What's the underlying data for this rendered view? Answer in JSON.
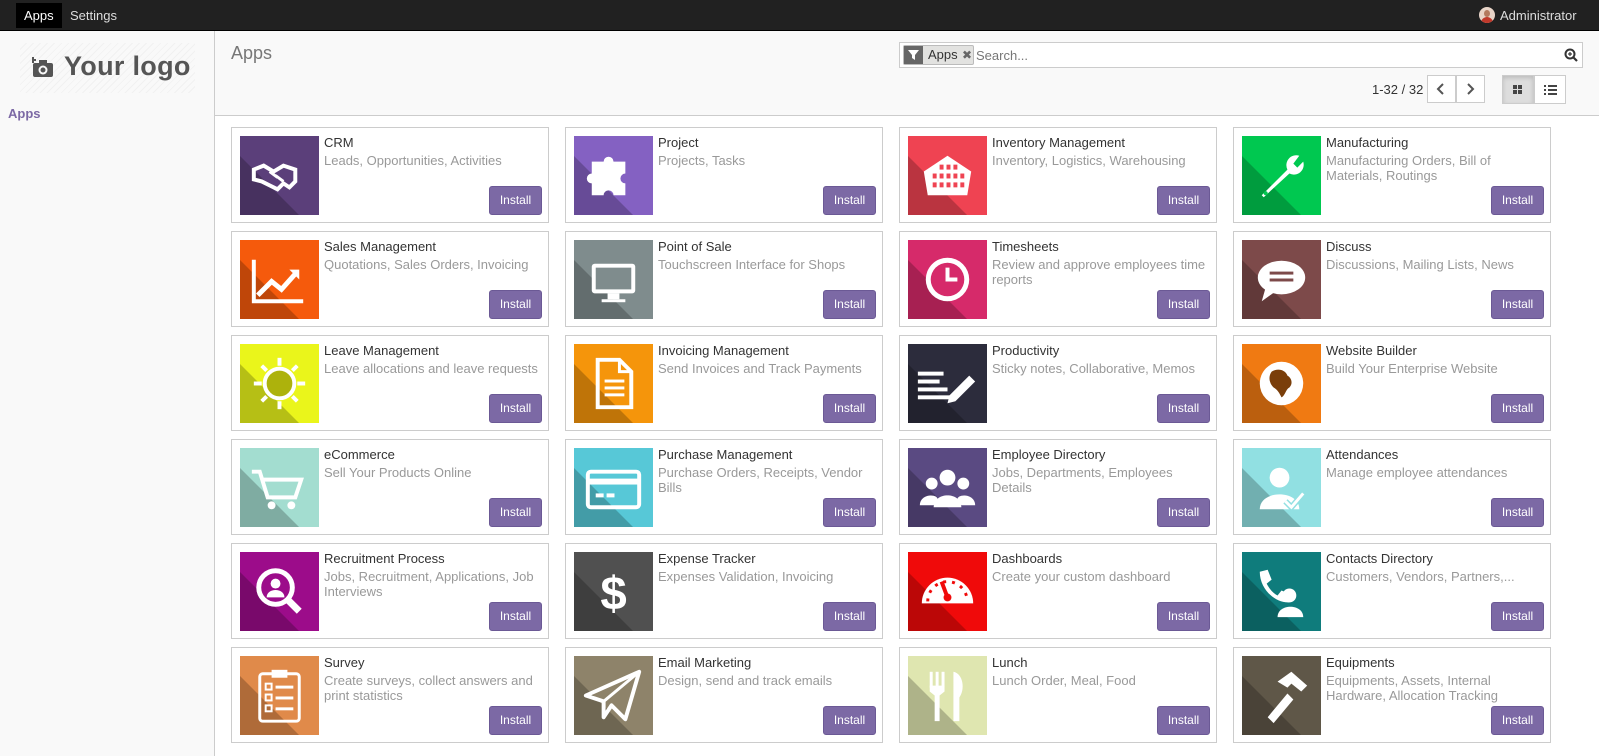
{
  "topbar": {
    "menus": [
      "Apps",
      "Settings"
    ],
    "user_name": "Administrator"
  },
  "sidebar": {
    "logo_text": "Your logo",
    "items": [
      "Apps"
    ]
  },
  "control": {
    "title": "Apps",
    "facet_label": "Apps",
    "search_placeholder": "Search...",
    "pager": "1-32 / 32"
  },
  "apps": [
    {
      "name": "CRM",
      "summary": "Leads, Opportunities, Activities",
      "color": "#5b3f7a",
      "icon": "handshake-icon",
      "button": "Install"
    },
    {
      "name": "Project",
      "summary": "Projects, Tasks",
      "color": "#8461c2",
      "icon": "puzzle-icon",
      "button": "Install"
    },
    {
      "name": "Inventory Management",
      "summary": "Inventory, Logistics, Warehousing",
      "color": "#ef4352",
      "icon": "warehouse-icon",
      "button": "Install"
    },
    {
      "name": "Manufacturing",
      "summary": "Manufacturing Orders, Bill of Materials, Routings",
      "color": "#00c850",
      "icon": "wrench-icon",
      "button": "Install"
    },
    {
      "name": "Sales Management",
      "summary": "Quotations, Sales Orders, Invoicing",
      "color": "#f55a0c",
      "icon": "chart-icon",
      "button": "Install"
    },
    {
      "name": "Point of Sale",
      "summary": "Touchscreen Interface for Shops",
      "color": "#7f8c8d",
      "icon": "monitor-icon",
      "button": "Install"
    },
    {
      "name": "Timesheets",
      "summary": "Review and approve employees time reports",
      "color": "#d62a6a",
      "icon": "clock-icon",
      "button": "Install"
    },
    {
      "name": "Discuss",
      "summary": "Discussions, Mailing Lists, News",
      "color": "#7d4a4a",
      "icon": "chat-icon",
      "button": "Install"
    },
    {
      "name": "Leave Management",
      "summary": "Leave allocations and leave requests",
      "color": "#eaf51b",
      "icon": "sun-icon",
      "button": "Install"
    },
    {
      "name": "Invoicing Management",
      "summary": "Send Invoices and Track Payments",
      "color": "#f5950b",
      "icon": "document-icon",
      "button": "Install"
    },
    {
      "name": "Productivity",
      "summary": "Sticky notes, Collaborative, Memos",
      "color": "#2c2c3c",
      "icon": "notes-pen-icon",
      "button": "Install"
    },
    {
      "name": "Website Builder",
      "summary": "Build Your Enterprise Website",
      "color": "#f07a12",
      "icon": "globe-icon",
      "button": "Install"
    },
    {
      "name": "eCommerce",
      "summary": "Sell Your Products Online",
      "color": "#a3ddd0",
      "icon": "cart-icon",
      "button": "Install"
    },
    {
      "name": "Purchase Management",
      "summary": "Purchase Orders, Receipts, Vendor Bills",
      "color": "#57c8d7",
      "icon": "credit-card-icon",
      "button": "Install"
    },
    {
      "name": "Employee Directory",
      "summary": "Jobs, Departments, Employees Details",
      "color": "#5a4a82",
      "icon": "users-icon",
      "button": "Install"
    },
    {
      "name": "Attendances",
      "summary": "Manage employee attendances",
      "color": "#91e0e2",
      "icon": "user-check-icon",
      "button": "Install"
    },
    {
      "name": "Recruitment Process",
      "summary": "Jobs, Recruitment, Applications, Job Interviews",
      "color": "#9c0c8a",
      "icon": "magnifier-user-icon",
      "button": "Install"
    },
    {
      "name": "Expense Tracker",
      "summary": "Expenses Validation, Invoicing",
      "color": "#505050",
      "icon": "dollar-icon",
      "button": "Install"
    },
    {
      "name": "Dashboards",
      "summary": "Create your custom dashboard",
      "color": "#f00a0a",
      "icon": "gauge-icon",
      "button": "Install"
    },
    {
      "name": "Contacts Directory",
      "summary": "Customers, Vendors, Partners,...",
      "color": "#0f7c7c",
      "icon": "phone-contact-icon",
      "button": "Install"
    },
    {
      "name": "Survey",
      "summary": "Create surveys, collect answers and print statistics",
      "color": "#e08a4a",
      "icon": "clipboard-icon",
      "button": "Install"
    },
    {
      "name": "Email Marketing",
      "summary": "Design, send and track emails",
      "color": "#8e836a",
      "icon": "paper-plane-icon",
      "button": "Install"
    },
    {
      "name": "Lunch",
      "summary": "Lunch Order, Meal, Food",
      "color": "#dfe6b0",
      "icon": "fork-knife-icon",
      "button": "Install"
    },
    {
      "name": "Equipments",
      "summary": "Equipments, Assets, Internal Hardware, Allocation Tracking",
      "color": "#5f5748",
      "icon": "hammer-icon",
      "button": "Install"
    }
  ]
}
